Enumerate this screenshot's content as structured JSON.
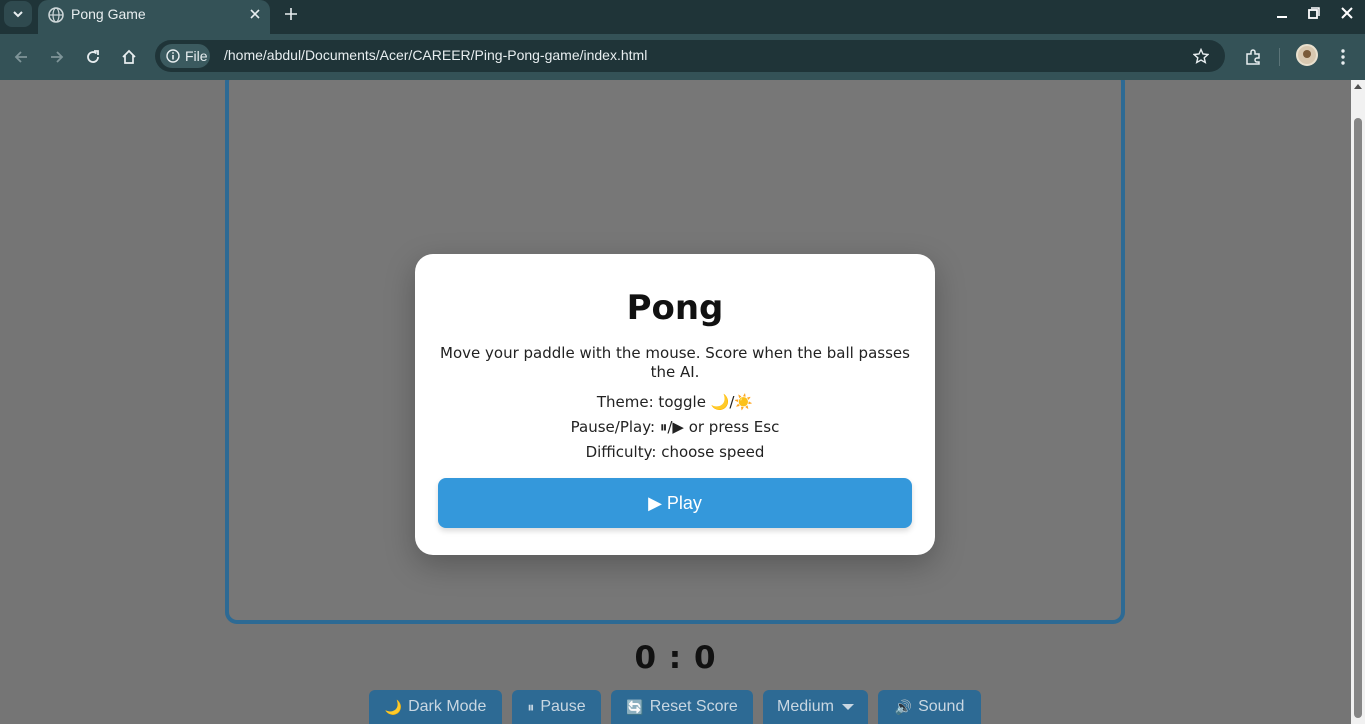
{
  "browser": {
    "tab_title": "Pong Game",
    "url_chip": "File",
    "url": "/home/abdul/Documents/Acer/CAREER/Ping-Pong-game/index.html"
  },
  "game": {
    "score": "0 : 0",
    "controls": [
      {
        "icon": "🌙",
        "label": "Dark Mode"
      },
      {
        "icon": "⏸",
        "label": "Pause"
      },
      {
        "icon": "🔄",
        "label": "Reset Score"
      },
      {
        "icon": "",
        "label": "Medium"
      },
      {
        "icon": "🔊",
        "label": "Sound"
      }
    ]
  },
  "modal": {
    "title": "Pong",
    "description": "Move your paddle with the mouse. Score when the ball passes the AI.",
    "theme_line": "Theme: toggle 🌙/☀️",
    "pause_line": "Pause/Play: ⏸/▶ or press Esc",
    "difficulty_line": "Difficulty: choose speed",
    "play_label": "▶ Play"
  },
  "colors": {
    "accent": "#3498db",
    "board_border": "#2d6a94",
    "overlay": "#757575"
  }
}
